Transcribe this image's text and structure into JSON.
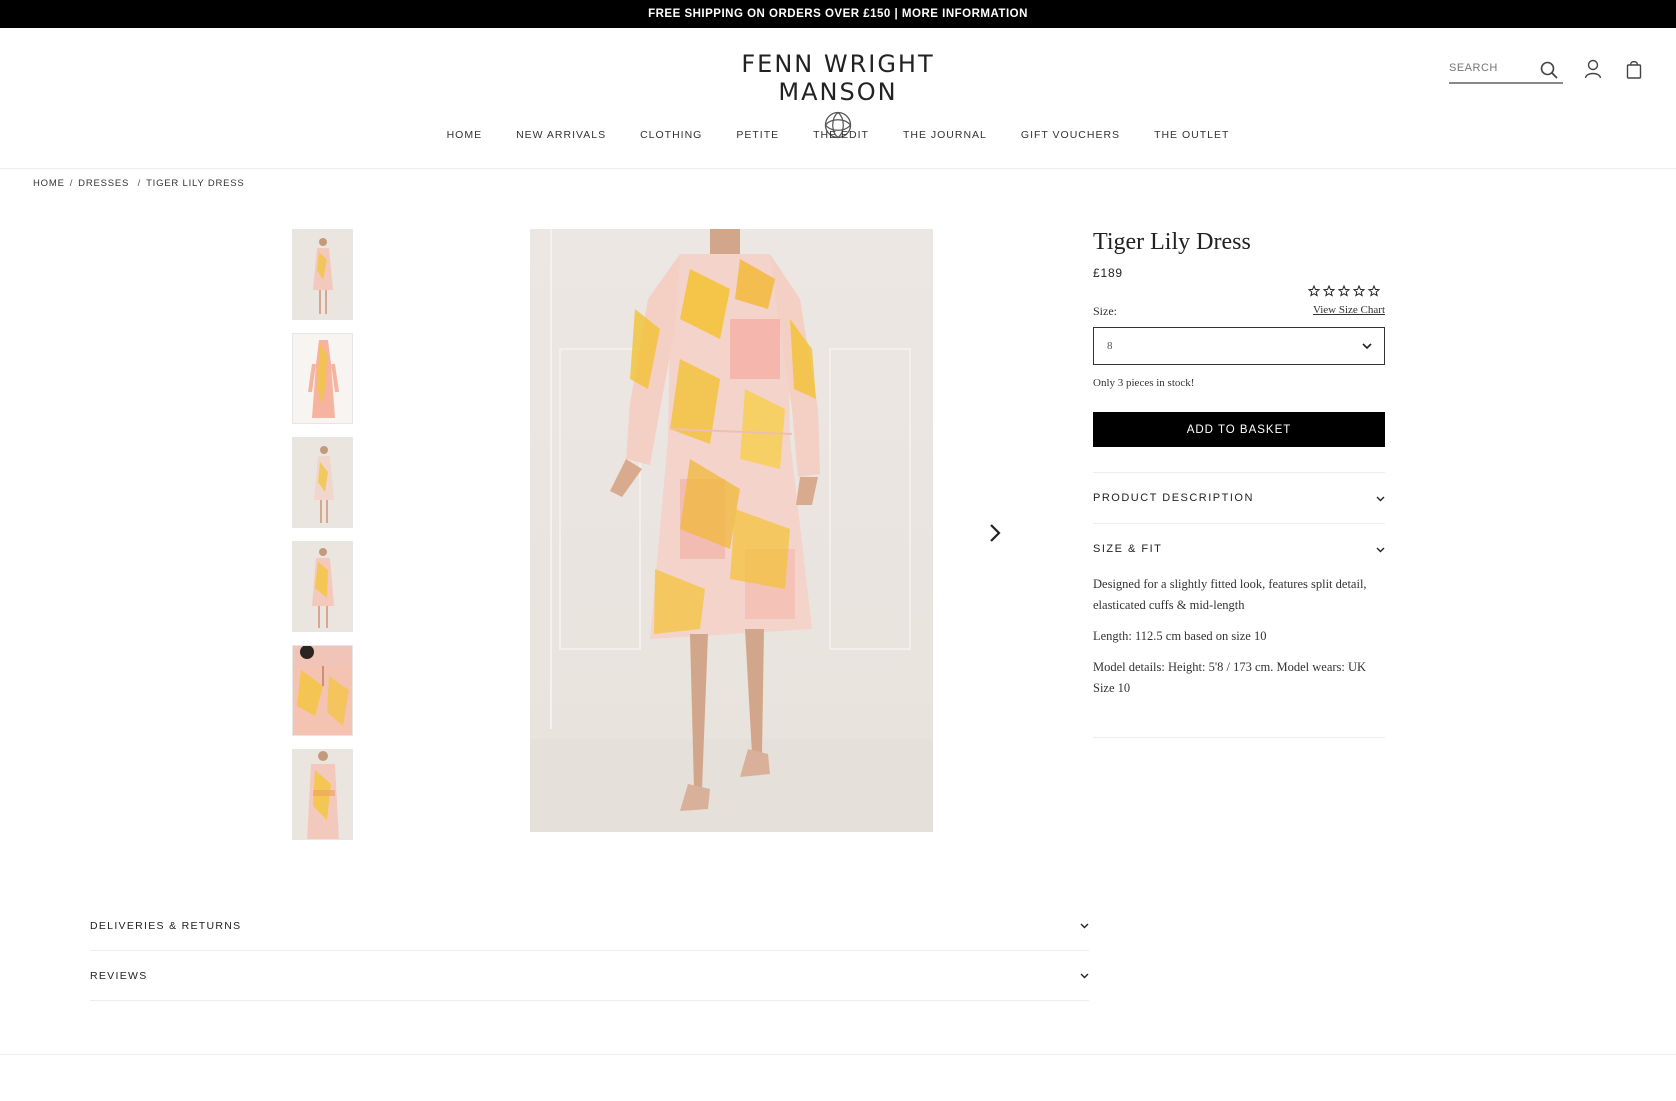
{
  "announcement": "FREE SHIPPING ON ORDERS OVER £150 | MORE INFORMATION",
  "brand": {
    "name": "FENN WRIGHT MANSON"
  },
  "search": {
    "placeholder": "SEARCH"
  },
  "nav": [
    "HOME",
    "NEW ARRIVALS",
    "CLOTHING",
    "PETITE",
    "THE EDIT",
    "THE JOURNAL",
    "GIFT VOUCHERS",
    "THE OUTLET"
  ],
  "breadcrumb": [
    "HOME",
    "DRESSES",
    "TIGER LILY DRESS"
  ],
  "gallery": {
    "thumbnail_count": 6,
    "icons": {
      "next": "chevron-right-icon"
    }
  },
  "product": {
    "title": "Tiger Lily Dress",
    "price": "£189",
    "rating": 0,
    "rating_max": 5,
    "size_chart_link": "View Size Chart",
    "size_label": "Size:",
    "selected_size": "8",
    "stock_message": "Only 3 pieces in stock!",
    "add_to_basket": "ADD TO BASKET",
    "accordions": {
      "description": "PRODUCT DESCRIPTION",
      "size_fit": "SIZE & FIT"
    },
    "size_fit": {
      "line1": "Designed for a slightly fitted look, features split detail, elasticated cuffs & mid-length",
      "line2": "Length: 112.5 cm based on size 10",
      "line3": "Model details: Height: 5'8 / 173 cm. Model wears: UK Size 10"
    }
  },
  "lower": {
    "deliveries": "DELIVERIES & RETURNS",
    "reviews": "REVIEWS"
  },
  "colors": {
    "accent": "#000000",
    "dress_pink": "#f2b8b0",
    "dress_yellow": "#f2c232"
  }
}
